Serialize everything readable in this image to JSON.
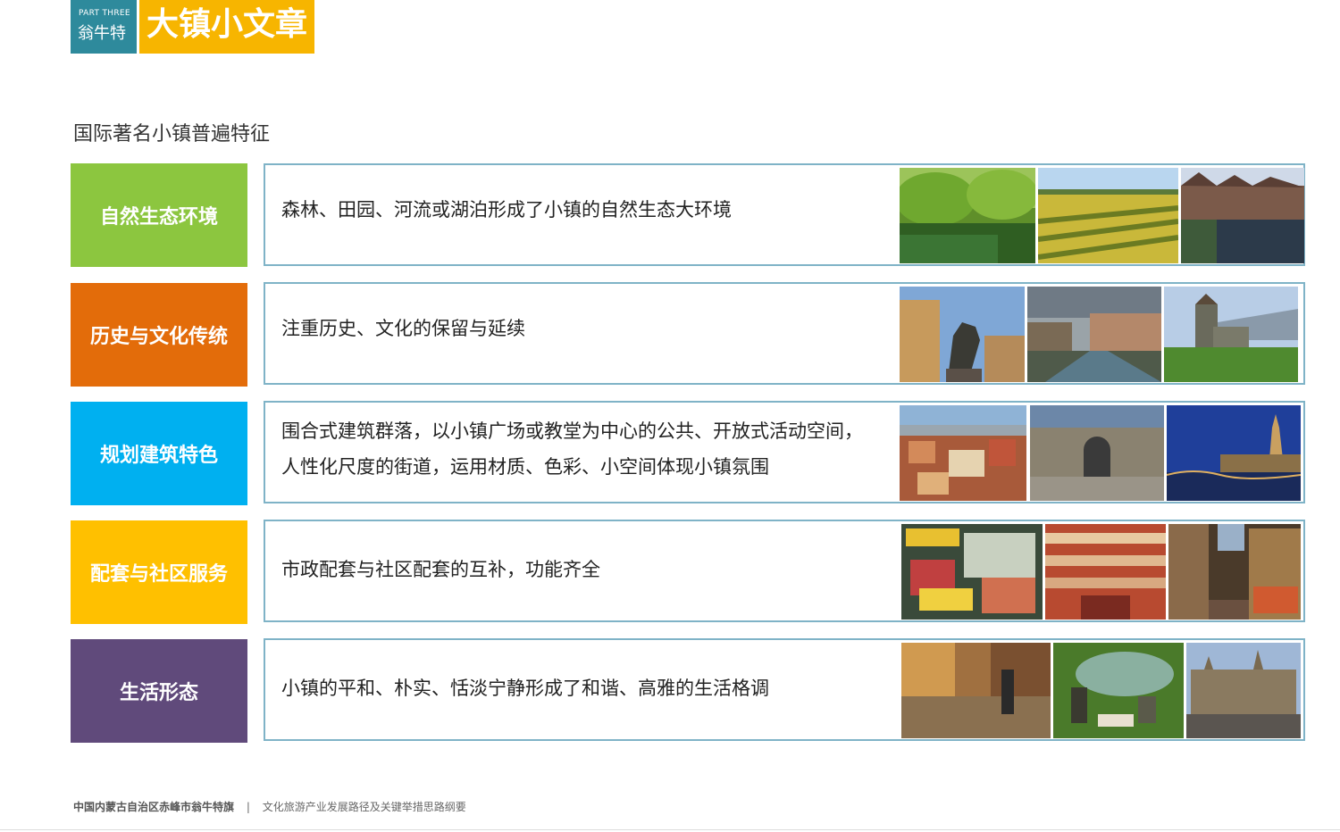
{
  "header": {
    "part_label": "PART THREE",
    "place_name": "翁牛特",
    "title": "大镇小文章"
  },
  "subtitle": "国际著名小镇普遍特征",
  "rows": [
    {
      "label": "自然生态环境",
      "color": "#8cc63f",
      "lines": [
        "森林、田园、河流或湖泊形成了小镇的自然生态大环境"
      ],
      "photos": [
        "forest-river-photo",
        "sunflower-field-photo",
        "lakeside-town-photo"
      ]
    },
    {
      "label": "历史与文化传统",
      "color": "#e36c0a",
      "lines": [
        "注重历史、文化的保留与延续"
      ],
      "photos": [
        "equestrian-statue-photo",
        "canal-street-photo",
        "hilltop-castle-photo"
      ]
    },
    {
      "label": "规划建筑特色",
      "color": "#00b0f0",
      "lines": [
        "围合式建筑群落，以小镇广场或教堂为中心的公共、开放式活动空间，",
        "人性化尺度的街道，运用材质、色彩、小空间体现小镇氛围"
      ],
      "photos": [
        "rooftops-aerial-photo",
        "arcade-square-photo",
        "night-cathedral-photo"
      ]
    },
    {
      "label": "配套与社区服务",
      "color": "#ffc000",
      "lines": [
        "市政配套与社区配套的互补，功能齐全"
      ],
      "photos": [
        "market-stall-photo",
        "library-interior-photo",
        "evening-street-photo"
      ]
    },
    {
      "label": "生活形态",
      "color": "#604a7b",
      "lines": [
        "小镇的平和、朴实、恬淡宁静形成了和谐、高雅的生活格调"
      ],
      "photos": [
        "street-musician-photo",
        "pond-picnic-photo",
        "gothic-square-photo"
      ]
    }
  ],
  "footer": {
    "location": "中国内蒙古自治区赤峰市翁牛特旗",
    "separator": "|",
    "document": "文化旅游产业发展路径及关键举措思路纲要"
  }
}
